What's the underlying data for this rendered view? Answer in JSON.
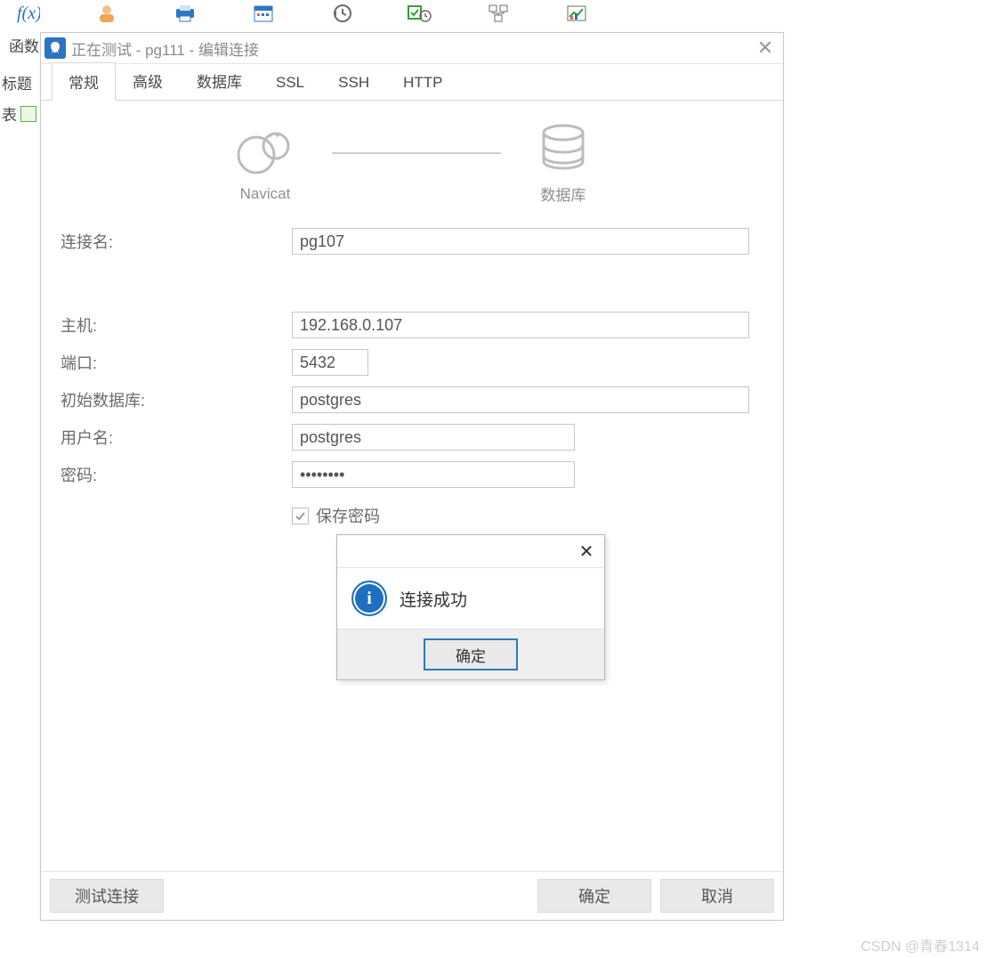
{
  "background": {
    "row2_left": "函数",
    "row3_left": "标题",
    "row4_left": "表",
    "toolbar_icons": [
      "fx-icon",
      "user-icon",
      "print-icon",
      "calendar-icon",
      "history-icon",
      "check-clock-icon",
      "schema-icon",
      "chart-icon"
    ]
  },
  "dialog": {
    "title": "正在测试 - pg111 - 编辑连接",
    "tabs": [
      "常规",
      "高级",
      "数据库",
      "SSL",
      "SSH",
      "HTTP"
    ],
    "active_tab": 0,
    "illustration": {
      "left": "Navicat",
      "right": "数据库"
    },
    "fields": {
      "conn_name": {
        "label": "连接名:",
        "value": "pg107"
      },
      "host": {
        "label": "主机:",
        "value": "192.168.0.107"
      },
      "port": {
        "label": "端口:",
        "value": "5432"
      },
      "initdb": {
        "label": "初始数据库:",
        "value": "postgres"
      },
      "user": {
        "label": "用户名:",
        "value": "postgres"
      },
      "password": {
        "label": "密码:",
        "value": "••••••••"
      },
      "save_pw": {
        "label": "保存密码",
        "checked": true
      }
    },
    "footer": {
      "test": "测试连接",
      "ok": "确定",
      "cancel": "取消"
    }
  },
  "msgbox": {
    "text": "连接成功",
    "ok": "确定"
  },
  "watermark": "CSDN @青春1314"
}
